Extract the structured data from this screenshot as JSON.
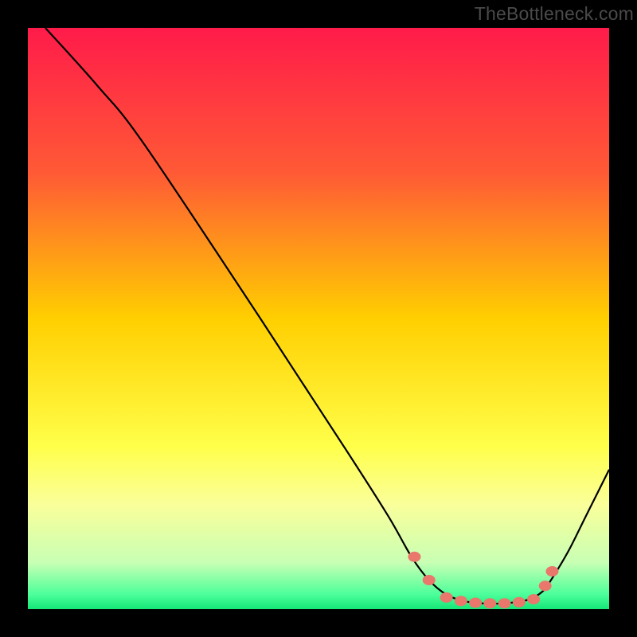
{
  "watermark": "TheBottleneck.com",
  "chart_data": {
    "type": "line",
    "title": "",
    "xlabel": "",
    "ylabel": "",
    "xlim": [
      0,
      100
    ],
    "ylim": [
      0,
      100
    ],
    "grid": false,
    "legend": false,
    "background_gradient": {
      "stops": [
        {
          "pos": 0.0,
          "color": "#ff1b4a"
        },
        {
          "pos": 0.25,
          "color": "#ff5a35"
        },
        {
          "pos": 0.5,
          "color": "#ffcf00"
        },
        {
          "pos": 0.72,
          "color": "#ffff4a"
        },
        {
          "pos": 0.82,
          "color": "#faff9a"
        },
        {
          "pos": 0.92,
          "color": "#c8ffb4"
        },
        {
          "pos": 0.975,
          "color": "#4bff9a"
        },
        {
          "pos": 1.0,
          "color": "#15e676"
        }
      ]
    },
    "curve": {
      "points_xy": [
        [
          3,
          100
        ],
        [
          12,
          90
        ],
        [
          20,
          80
        ],
        [
          40,
          50
        ],
        [
          55,
          27
        ],
        [
          62,
          16
        ],
        [
          66,
          9
        ],
        [
          69,
          5
        ],
        [
          72,
          2.5
        ],
        [
          75,
          1.4
        ],
        [
          78,
          1.0
        ],
        [
          82,
          1.0
        ],
        [
          86,
          1.6
        ],
        [
          88.5,
          3
        ],
        [
          90,
          5
        ],
        [
          93,
          10
        ],
        [
          96,
          16
        ],
        [
          100,
          24
        ]
      ]
    },
    "markers_xy": [
      [
        66.5,
        9.0
      ],
      [
        69.0,
        5.0
      ],
      [
        72.0,
        2.0
      ],
      [
        74.5,
        1.4
      ],
      [
        77.0,
        1.1
      ],
      [
        79.5,
        1.0
      ],
      [
        82.0,
        1.0
      ],
      [
        84.5,
        1.2
      ],
      [
        87.0,
        1.7
      ],
      [
        89.0,
        4.0
      ],
      [
        90.2,
        6.5
      ]
    ]
  }
}
